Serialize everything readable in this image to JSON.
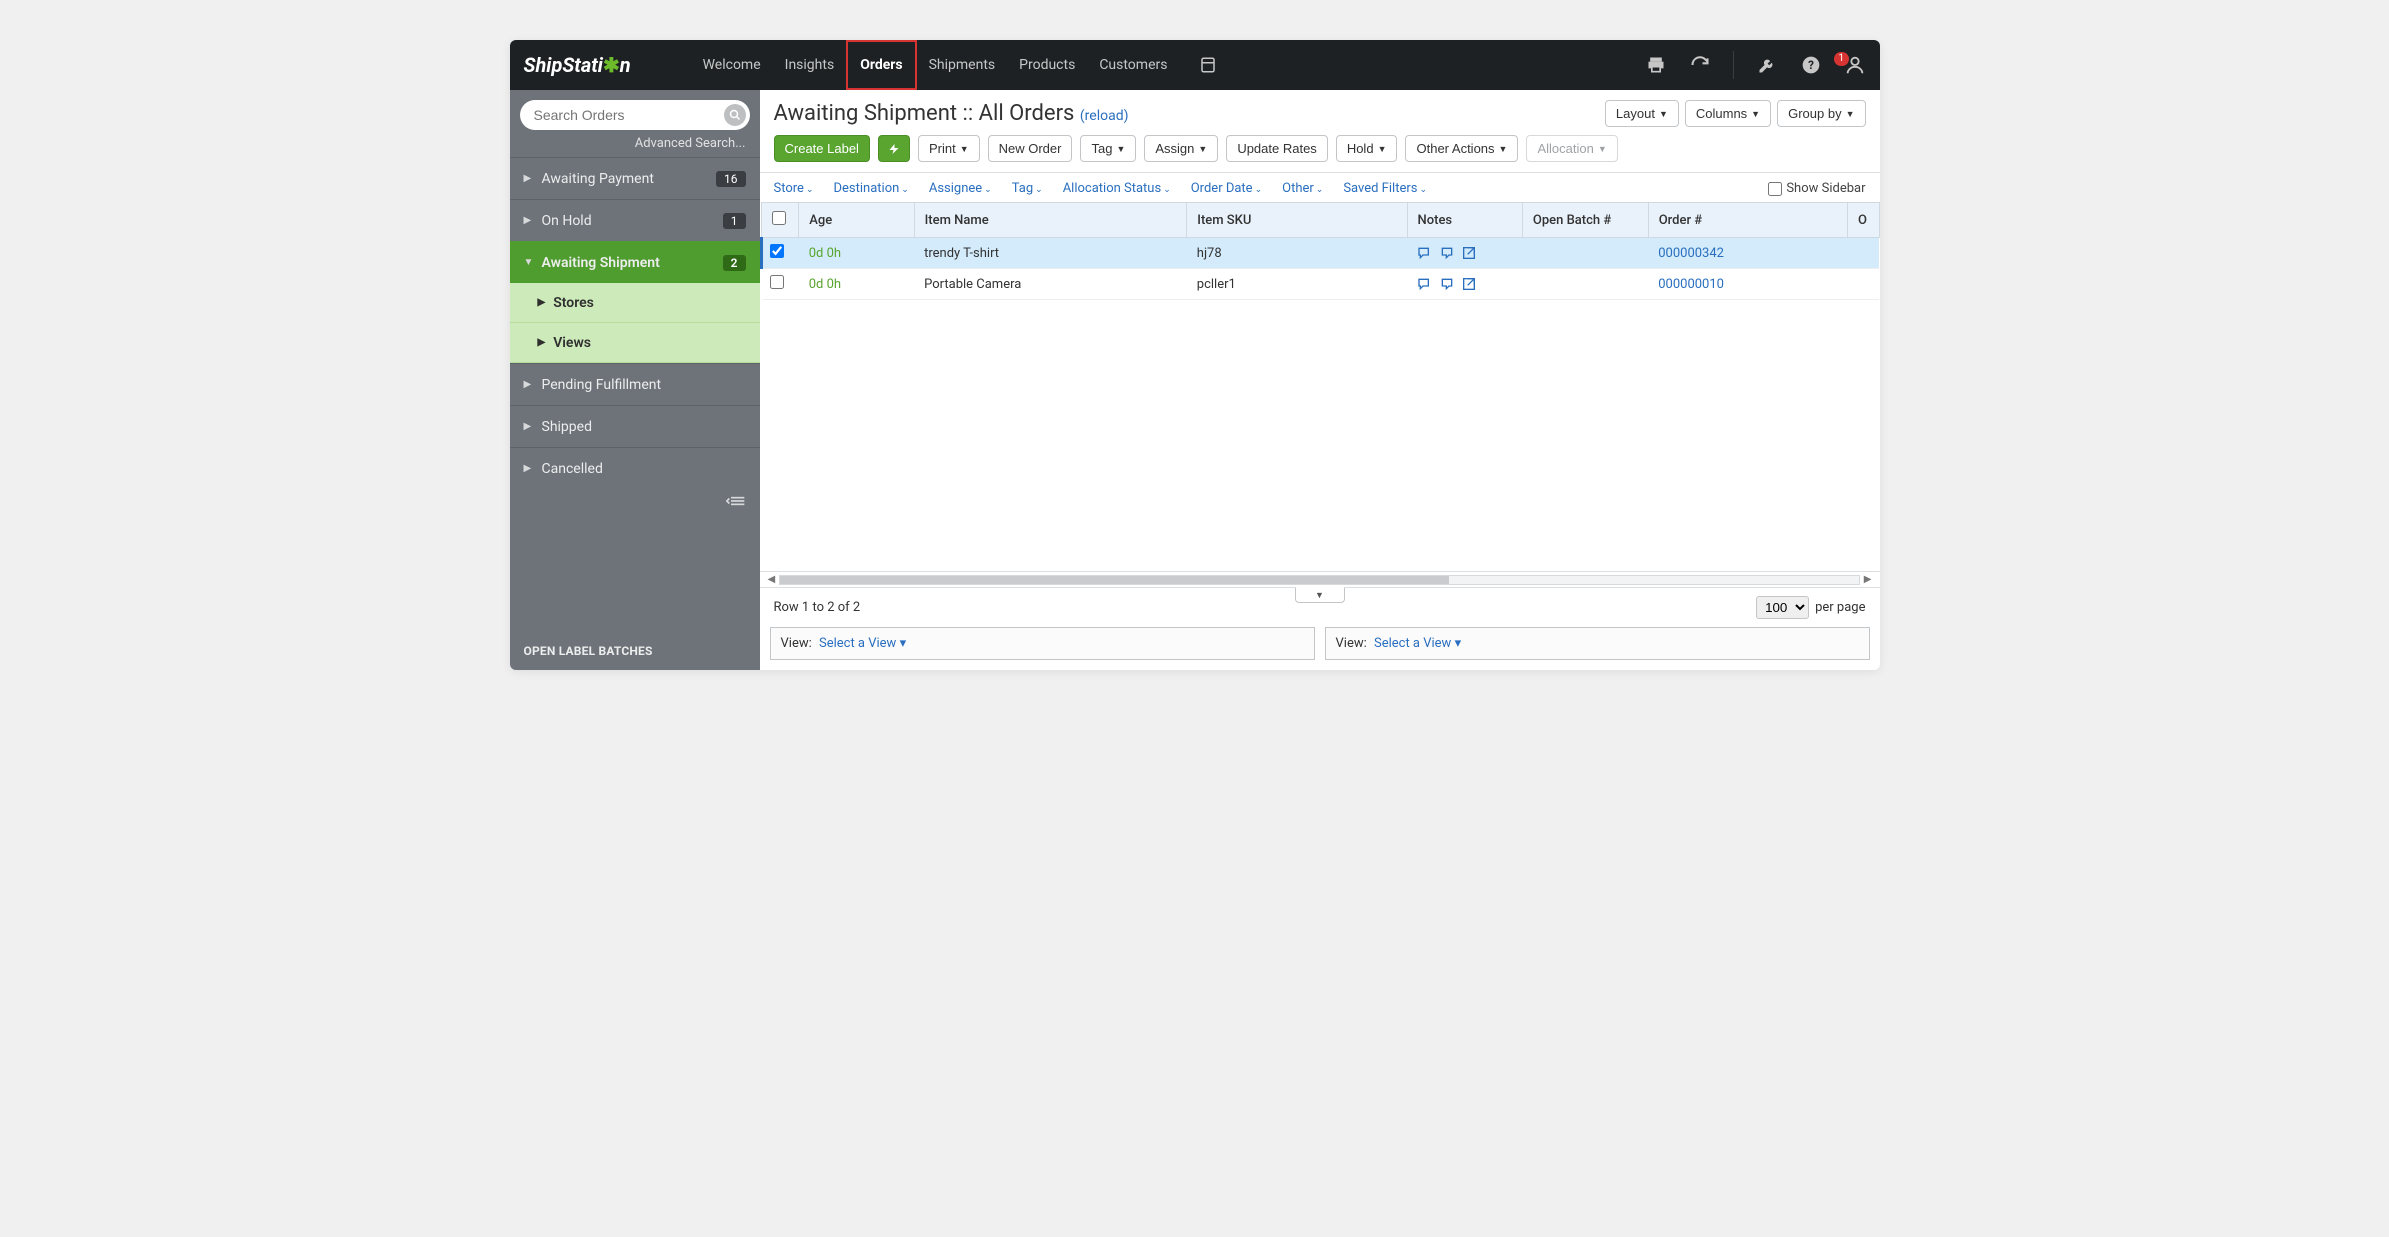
{
  "logo_prefix": "ShipStati",
  "logo_suffix": "n",
  "nav": {
    "items": [
      "Welcome",
      "Insights",
      "Orders",
      "Shipments",
      "Products",
      "Customers"
    ],
    "active": "Orders"
  },
  "topicons": {
    "notify_count": "1"
  },
  "sidebar": {
    "search_placeholder": "Search Orders",
    "advanced": "Advanced Search...",
    "items": [
      {
        "label": "Awaiting Payment",
        "badge": "16"
      },
      {
        "label": "On Hold",
        "badge": "1"
      },
      {
        "label": "Awaiting Shipment",
        "badge": "2",
        "active": true,
        "open": true
      },
      {
        "label": "Pending Fulfillment"
      },
      {
        "label": "Shipped"
      },
      {
        "label": "Cancelled"
      }
    ],
    "subitems": [
      "Stores",
      "Views"
    ],
    "open_batches": "OPEN LABEL BATCHES"
  },
  "header": {
    "title": "Awaiting Shipment :: All Orders ",
    "reload": "(reload)",
    "layout": "Layout",
    "columns": "Columns",
    "groupby": "Group by"
  },
  "toolbar": {
    "create_label": "Create Label",
    "print": "Print",
    "new_order": "New Order",
    "tag": "Tag",
    "assign": "Assign",
    "update_rates": "Update Rates",
    "hold": "Hold",
    "other_actions": "Other Actions",
    "allocation": "Allocation"
  },
  "filters": {
    "items": [
      "Store",
      "Destination",
      "Assignee",
      "Tag",
      "Allocation Status",
      "Order Date",
      "Other",
      "Saved Filters"
    ],
    "show_sidebar": "Show Sidebar"
  },
  "table": {
    "columns": [
      "",
      "Age",
      "Item Name",
      "Item SKU",
      "Notes",
      "Open Batch #",
      "Order #",
      "O"
    ],
    "rows": [
      {
        "selected": true,
        "age": "0d 0h",
        "item_name": "trendy T-shirt",
        "sku": "hj78",
        "order": "000000342"
      },
      {
        "selected": false,
        "age": "0d 0h",
        "item_name": "Portable Camera",
        "sku": "pcller1",
        "order": "000000010"
      }
    ]
  },
  "footer": {
    "rowtext": "Row 1 to 2 of 2",
    "perpage_value": "100",
    "perpage_label": "per page"
  },
  "views": {
    "label": "View:",
    "select": "Select a View"
  }
}
